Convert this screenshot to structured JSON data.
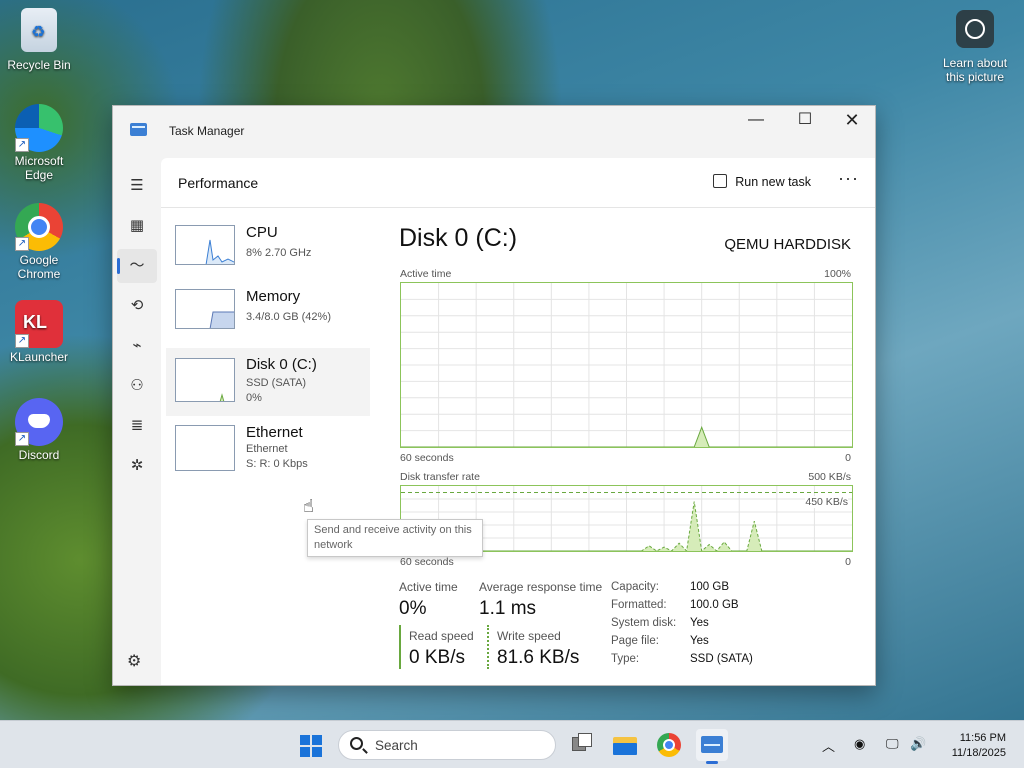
{
  "desktop": {
    "icons": [
      {
        "label": "Recycle Bin"
      },
      {
        "label": "Microsoft Edge"
      },
      {
        "label": "Google Chrome"
      },
      {
        "label": "KLauncher"
      },
      {
        "label": "Discord"
      }
    ],
    "spotlight": {
      "label": "Learn about this picture"
    }
  },
  "window": {
    "title": "Task Manager",
    "controls": {
      "minimize": "—",
      "maximize": "☐",
      "close": "✕"
    }
  },
  "header": {
    "page_title": "Performance",
    "run_task_label": "Run new task",
    "more_label": "···"
  },
  "devices": [
    {
      "name": "CPU",
      "sub1": "8%  2.70 GHz",
      "sub2": ""
    },
    {
      "name": "Memory",
      "sub1": "3.4/8.0 GB (42%)",
      "sub2": ""
    },
    {
      "name": "Disk 0 (C:)",
      "sub1": "SSD (SATA)",
      "sub2": "0%"
    },
    {
      "name": "Ethernet",
      "sub1": "Ethernet",
      "sub2": "S: R: 0 Kbps"
    }
  ],
  "tooltip": "Send and receive activity on this network",
  "detail": {
    "title": "Disk 0 (C:)",
    "model": "QEMU HARDDISK",
    "active_chart": {
      "label": "Active time",
      "max": "100%",
      "x_label": "60 seconds",
      "min": "0"
    },
    "transfer_chart": {
      "label": "Disk transfer rate",
      "max": "500 KB/s",
      "line_label": "450 KB/s",
      "x_label": "60 seconds",
      "min": "0"
    }
  },
  "chart_data": [
    {
      "type": "area",
      "title": "Active time",
      "ylim": [
        0,
        100
      ],
      "x": [
        0,
        5,
        10,
        15,
        20,
        25,
        30,
        35,
        38,
        39,
        40,
        41,
        45,
        50,
        55,
        60
      ],
      "series": [
        {
          "values": [
            0,
            0,
            0,
            0,
            0,
            0,
            0,
            0,
            0,
            0,
            12,
            0,
            0,
            0,
            0,
            0
          ]
        }
      ]
    },
    {
      "type": "line",
      "title": "Disk transfer rate",
      "ylim": [
        0,
        500
      ],
      "x": [
        0,
        5,
        10,
        15,
        20,
        25,
        30,
        32,
        33,
        34,
        35,
        36,
        37,
        38,
        39,
        40,
        41,
        42,
        43,
        44,
        45,
        46,
        47,
        48,
        49,
        50,
        55,
        60
      ],
      "series": [
        {
          "values": [
            0,
            0,
            0,
            0,
            0,
            0,
            0,
            0,
            0,
            0,
            0,
            0,
            0,
            0,
            0,
            0,
            0,
            0,
            0,
            0,
            0,
            0,
            0,
            0,
            0,
            0,
            0,
            0
          ]
        },
        {
          "values": [
            0,
            0,
            0,
            0,
            0,
            0,
            0,
            0,
            40,
            0,
            30,
            0,
            60,
            0,
            380,
            0,
            50,
            0,
            70,
            0,
            0,
            0,
            230,
            0,
            0,
            0,
            0,
            0
          ]
        }
      ]
    }
  ],
  "stats": {
    "active_time_label": "Active time",
    "active_time_value": "0%",
    "avg_resp_label": "Average response time",
    "avg_resp_value": "1.1 ms",
    "read_label": "Read speed",
    "read_value": "0 KB/s",
    "write_label": "Write speed",
    "write_value": "81.6 KB/s"
  },
  "properties": [
    {
      "key": "Capacity:",
      "value": "100 GB"
    },
    {
      "key": "Formatted:",
      "value": "100.0 GB"
    },
    {
      "key": "System disk:",
      "value": "Yes"
    },
    {
      "key": "Page file:",
      "value": "Yes"
    },
    {
      "key": "Type:",
      "value": "SSD (SATA)"
    }
  ],
  "taskbar": {
    "search_placeholder": "Search",
    "time": "11:56 PM",
    "date": "11/18/2025"
  },
  "colors": {
    "accent": "#2b6dd4",
    "disk_green": "#69a83f",
    "disk_fill": "#d6ecb9"
  }
}
